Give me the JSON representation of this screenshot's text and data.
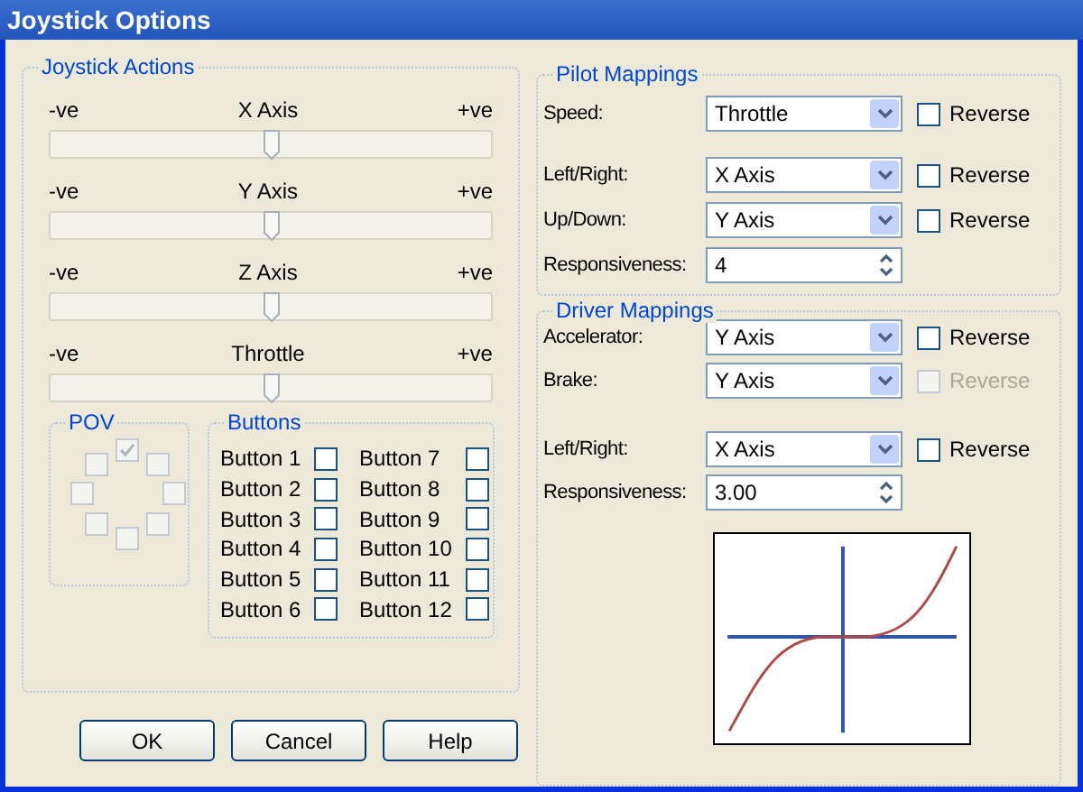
{
  "window": {
    "title": "Joystick Options"
  },
  "joystick_actions": {
    "title": "Joystick Actions",
    "axes": [
      {
        "min_label": "-ve",
        "name": "X Axis",
        "max_label": "+ve",
        "level": 0.5
      },
      {
        "min_label": "-ve",
        "name": "Y Axis",
        "max_label": "+ve",
        "level": 0.5
      },
      {
        "min_label": "-ve",
        "name": "Z Axis",
        "max_label": "+ve",
        "level": 0.5
      },
      {
        "min_label": "-ve",
        "name": "Throttle",
        "max_label": "+ve",
        "level": 0.5
      }
    ]
  },
  "pov": {
    "title": "POV",
    "directions": [
      {
        "checked": true,
        "disabled": true
      },
      {
        "checked": false,
        "disabled": true
      },
      {
        "checked": false,
        "disabled": true
      },
      {
        "checked": false,
        "disabled": true
      },
      {
        "checked": false,
        "disabled": true
      },
      {
        "checked": false,
        "disabled": true
      },
      {
        "checked": false,
        "disabled": true
      },
      {
        "checked": false,
        "disabled": true
      }
    ]
  },
  "buttons_group": {
    "title": "Buttons",
    "buttons": [
      {
        "label": "Button 1",
        "checked": false
      },
      {
        "label": "Button 2",
        "checked": false
      },
      {
        "label": "Button 3",
        "checked": false
      },
      {
        "label": "Button 4",
        "checked": false
      },
      {
        "label": "Button 5",
        "checked": false
      },
      {
        "label": "Button 6",
        "checked": false
      },
      {
        "label": "Button 7",
        "checked": false
      },
      {
        "label": "Button 8",
        "checked": false
      },
      {
        "label": "Button 9",
        "checked": false
      },
      {
        "label": "Button 10",
        "checked": false
      },
      {
        "label": "Button 11",
        "checked": false
      },
      {
        "label": "Button 12",
        "checked": false
      }
    ]
  },
  "pilot_mappings": {
    "title": "Pilot Mappings",
    "rows": [
      {
        "kind": "select",
        "label": "Speed:",
        "value": "Throttle",
        "reverse": {
          "label": "Reverse",
          "checked": false,
          "disabled": false
        }
      },
      {
        "kind": "select",
        "label": "Left/Right:",
        "value": "X Axis",
        "reverse": {
          "label": "Reverse",
          "checked": false,
          "disabled": false
        }
      },
      {
        "kind": "select",
        "label": "Up/Down:",
        "value": "Y Axis",
        "reverse": {
          "label": "Reverse",
          "checked": false,
          "disabled": false
        }
      },
      {
        "kind": "spin",
        "label": "Responsiveness:",
        "value": "4"
      }
    ]
  },
  "driver_mappings": {
    "title": "Driver Mappings",
    "rows": [
      {
        "kind": "select",
        "label": "Accelerator:",
        "value": "Y Axis",
        "reverse": {
          "label": "Reverse",
          "checked": false,
          "disabled": false
        }
      },
      {
        "kind": "select",
        "label": "Brake:",
        "value": "Y Axis",
        "reverse": {
          "label": "Reverse",
          "checked": false,
          "disabled": true
        }
      },
      {
        "kind": "select",
        "label": "Left/Right:",
        "value": "X Axis",
        "reverse": {
          "label": "Reverse",
          "checked": false,
          "disabled": false
        }
      },
      {
        "kind": "spin",
        "label": "Responsiveness:",
        "value": "3.00"
      }
    ]
  },
  "actions": [
    "OK",
    "Cancel",
    "Help"
  ]
}
